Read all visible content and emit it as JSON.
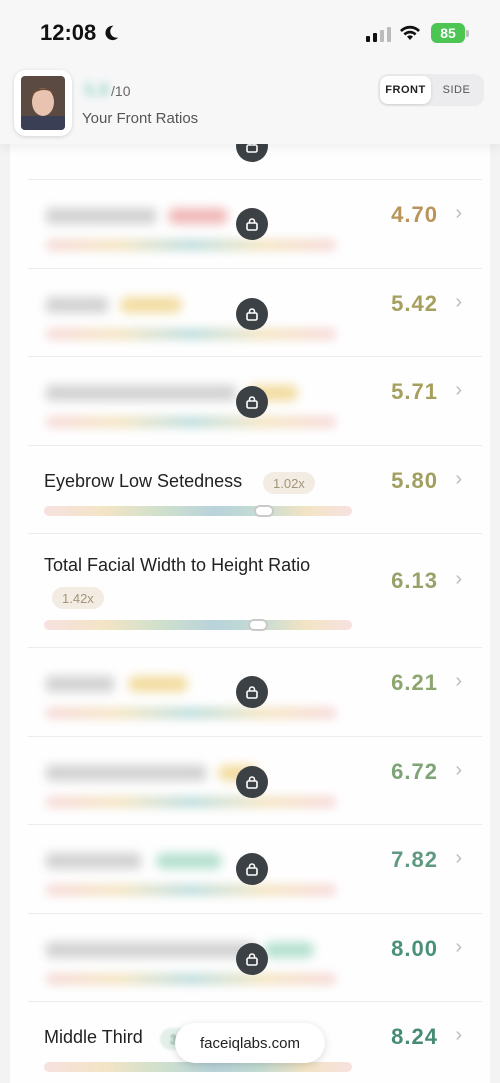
{
  "status": {
    "time": "12:08",
    "battery": "85"
  },
  "header": {
    "score_suffix": "/10",
    "score_blurred": "5.8",
    "title": "Your Front Ratios"
  },
  "toggle": {
    "front": "FRONT",
    "side": "SIDE",
    "active": "FRONT"
  },
  "colors": {
    "gold": "#b8945a",
    "olive": "#a0a060",
    "green": "#5e9a80",
    "teal": "#3f8a74"
  },
  "rows": [
    {
      "locked": true,
      "value": "4.70",
      "color": "#b8945a"
    },
    {
      "locked": true,
      "value": "5.42",
      "color": "#a6a05e"
    },
    {
      "locked": true,
      "value": "5.71",
      "color": "#a6a05e"
    },
    {
      "locked": false,
      "name": "Eyebrow Low Setedness",
      "badge": "1.02x",
      "value": "5.80",
      "color": "#a09f5f"
    },
    {
      "locked": false,
      "name": "Total Facial Width to Height Ratio",
      "badge": "1.42x",
      "value": "6.13",
      "color": "#96a268"
    },
    {
      "locked": true,
      "value": "6.21",
      "color": "#8da56e"
    },
    {
      "locked": true,
      "value": "6.72",
      "color": "#7ca474"
    },
    {
      "locked": true,
      "value": "7.82",
      "color": "#5e9a80"
    },
    {
      "locked": true,
      "value": "8.00",
      "color": "#4a9179"
    },
    {
      "locked": false,
      "name": "Middle Third",
      "value": "8.24",
      "color": "#478b74"
    }
  ],
  "watermark": "faceiqlabs.com"
}
